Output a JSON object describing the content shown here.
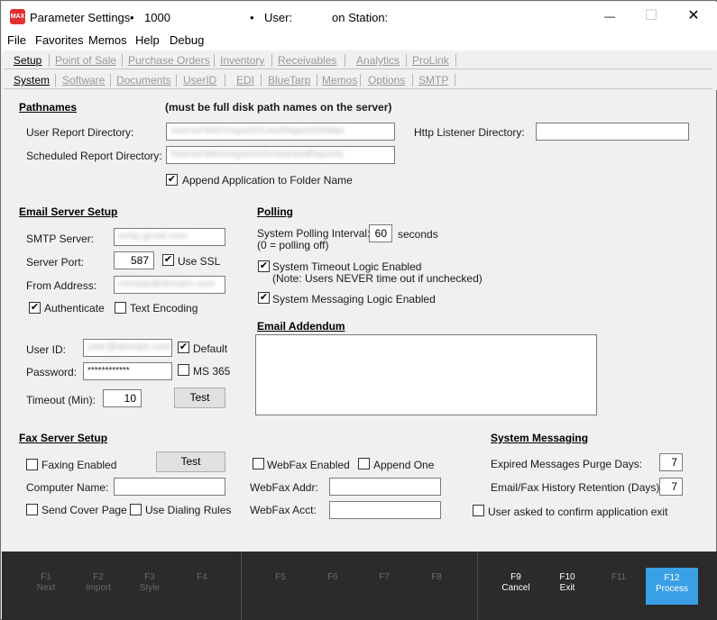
{
  "window": {
    "app_icon_text": "MAX",
    "title": "Parameter Settings",
    "bullet1": "•",
    "number": "1000",
    "bullet2": "•",
    "user_label": "User:",
    "station_label": "on Station:",
    "min_glyph": "—",
    "max_glyph": "☐",
    "close_glyph": "✕"
  },
  "menu": [
    "File",
    "Favorites",
    "Memos",
    "Help",
    "Debug"
  ],
  "top_tabs": [
    "Setup",
    "Point of Sale",
    "Purchase Orders",
    "Inventory",
    "Receivables",
    "Analytics",
    "ProLink"
  ],
  "sub_tabs": [
    "System",
    "Software",
    "Documents",
    "UserID",
    "EDI",
    "BlueTarp",
    "Memos",
    "Options",
    "SMTP"
  ],
  "pathnames": {
    "header": "Pathnames",
    "note": "(must be full disk path names on the server)",
    "user_report_label": "User Report Directory:",
    "user_report_value": "\\\\server\\MAXreports\\UserReports\\folder",
    "scheduled_report_label": "Scheduled Report Directory:",
    "scheduled_report_value": "\\\\server\\MAXreports\\ScheduledReports",
    "http_listener_label": "Http Listener Directory:",
    "http_listener_value": "",
    "append_label": "Append Application to Folder Name",
    "append_checked": "✔"
  },
  "email": {
    "header": "Email Server Setup",
    "smtp_label": "SMTP Server:",
    "smtp_value": "smtp.gmail.com",
    "port_label": "Server Port:",
    "port_value": "587",
    "ssl_label": "Use SSL",
    "ssl_checked": "✔",
    "from_label": "From Address:",
    "from_value": "noreply@domain.com",
    "auth_label": "Authenticate",
    "auth_checked": "✔",
    "text_enc_label": "Text Encoding",
    "text_enc_checked": "",
    "userid_label": "User ID:",
    "userid_value": "user@domain.com",
    "default_label": "Default",
    "default_checked": "✔",
    "password_label": "Password:",
    "password_value": "************",
    "ms365_label": "MS 365",
    "ms365_checked": "",
    "timeout_label": "Timeout (Min):",
    "timeout_value": "10",
    "test_label": "Test"
  },
  "polling": {
    "header": "Polling",
    "interval_label": "System Polling Interval:",
    "interval_note": "(0 = polling off)",
    "interval_value": "60",
    "interval_unit": "seconds",
    "timeout_logic_label": "System Timeout Logic Enabled",
    "timeout_logic_note": "(Note: Users NEVER time out if unchecked)",
    "timeout_logic_checked": "✔",
    "messaging_logic_label": "System Messaging Logic Enabled",
    "messaging_logic_checked": "✔"
  },
  "addendum": {
    "header": "Email Addendum",
    "value": ""
  },
  "fax": {
    "header": "Fax Server Setup",
    "faxing_label": "Faxing Enabled",
    "faxing_checked": "",
    "test_label": "Test",
    "computer_label": "Computer Name:",
    "computer_value": "",
    "cover_label": "Send Cover Page",
    "cover_checked": "",
    "dialing_label": "Use Dialing Rules",
    "dialing_checked": "",
    "webfax_label": "WebFax Enabled",
    "webfax_checked": "",
    "append_one_label": "Append One",
    "append_one_checked": "",
    "webfax_addr_label": "WebFax Addr:",
    "webfax_addr_value": "",
    "webfax_acct_label": "WebFax Acct:",
    "webfax_acct_value": ""
  },
  "messaging": {
    "header": "System Messaging",
    "purge_label": "Expired Messages Purge Days:",
    "purge_value": "7",
    "history_label": "Email/Fax History Retention (Days):",
    "history_value": "7",
    "confirm_label": "User asked to confirm application exit",
    "confirm_checked": ""
  },
  "fkeys": [
    {
      "key": "F1",
      "label": "Next"
    },
    {
      "key": "F2",
      "label": "Import"
    },
    {
      "key": "F3",
      "label": "Style"
    },
    {
      "key": "F4",
      "label": ""
    },
    {
      "key": "F5",
      "label": ""
    },
    {
      "key": "F6",
      "label": ""
    },
    {
      "key": "F7",
      "label": ""
    },
    {
      "key": "F8",
      "label": ""
    },
    {
      "key": "F9",
      "label": "Cancel"
    },
    {
      "key": "F10",
      "label": "Exit"
    },
    {
      "key": "F11",
      "label": ""
    },
    {
      "key": "F12",
      "label": "Process"
    }
  ],
  "colors": {
    "primary_fkey": "#3aa0e6",
    "fkey_bar": "#2b2b2b",
    "app_icon": "#e03131"
  }
}
